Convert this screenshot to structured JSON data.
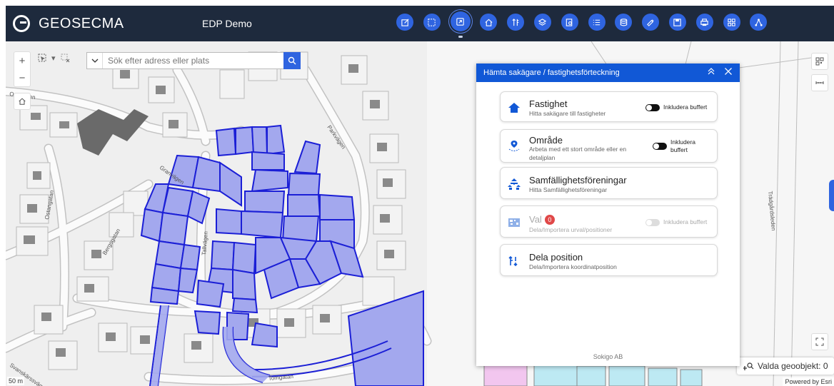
{
  "header": {
    "logo_text": "GEOSECMA",
    "app_title": "EDP Demo",
    "tools": [
      {
        "icon": "edit-icon"
      },
      {
        "icon": "select-area-icon"
      },
      {
        "icon": "share-icon",
        "active": true
      },
      {
        "icon": "home-icon"
      },
      {
        "icon": "sort-icon"
      },
      {
        "icon": "layers-icon"
      },
      {
        "icon": "search-doc-icon"
      },
      {
        "icon": "list-icon"
      },
      {
        "icon": "database-icon"
      },
      {
        "icon": "paint-icon"
      },
      {
        "icon": "save-icon"
      },
      {
        "icon": "print-icon"
      },
      {
        "icon": "grid-icon"
      },
      {
        "icon": "network-icon"
      }
    ]
  },
  "search": {
    "placeholder": "Sök efter adress eller plats"
  },
  "map": {
    "streets": [
      "Ostenlden",
      "Granvägen",
      "Parkvägen",
      "Ostangatan",
      "Bergsgatan",
      "Tallvägen",
      "Svanskärssvägen",
      "Tomgatan",
      "Trädgårdsleden"
    ],
    "scale_label": "50 m",
    "attribution": "Powered by Esri",
    "selected_label": "Valda geoobjekt: 0"
  },
  "panel": {
    "title": "Hämta sakägare / fastighetsförteckning",
    "cards": [
      {
        "title": "Fastighet",
        "subtitle": "Hitta sakägare till fastigheter",
        "toggle_label": "Inkludera buffert",
        "icon": "house-icon"
      },
      {
        "title": "Område",
        "subtitle": "Arbeta med ett stort område eller en detaljplan",
        "toggle_label": "Inkludera buffert",
        "icon": "area-pin-icon"
      },
      {
        "title": "Samfällighetsföreningar",
        "subtitle": "Hitta Samfällighetsföreningar",
        "icon": "association-icon"
      },
      {
        "title": "Val",
        "badge": "0",
        "subtitle": "Dela/Importera urval/positioner",
        "toggle_label": "Inkludera buffert",
        "icon": "qr-icon",
        "disabled": true
      },
      {
        "title": "Dela position",
        "subtitle": "Dela/Importera koordinatposition",
        "icon": "position-icon"
      }
    ],
    "footer": "Sokigo AB"
  },
  "colors": {
    "header_bg": "#1e2a3d",
    "accent": "#2f64e0",
    "panel_head": "#1158d6",
    "parcel_fill": "#a3a8ee",
    "parcel_stroke": "#1b1fd6"
  }
}
